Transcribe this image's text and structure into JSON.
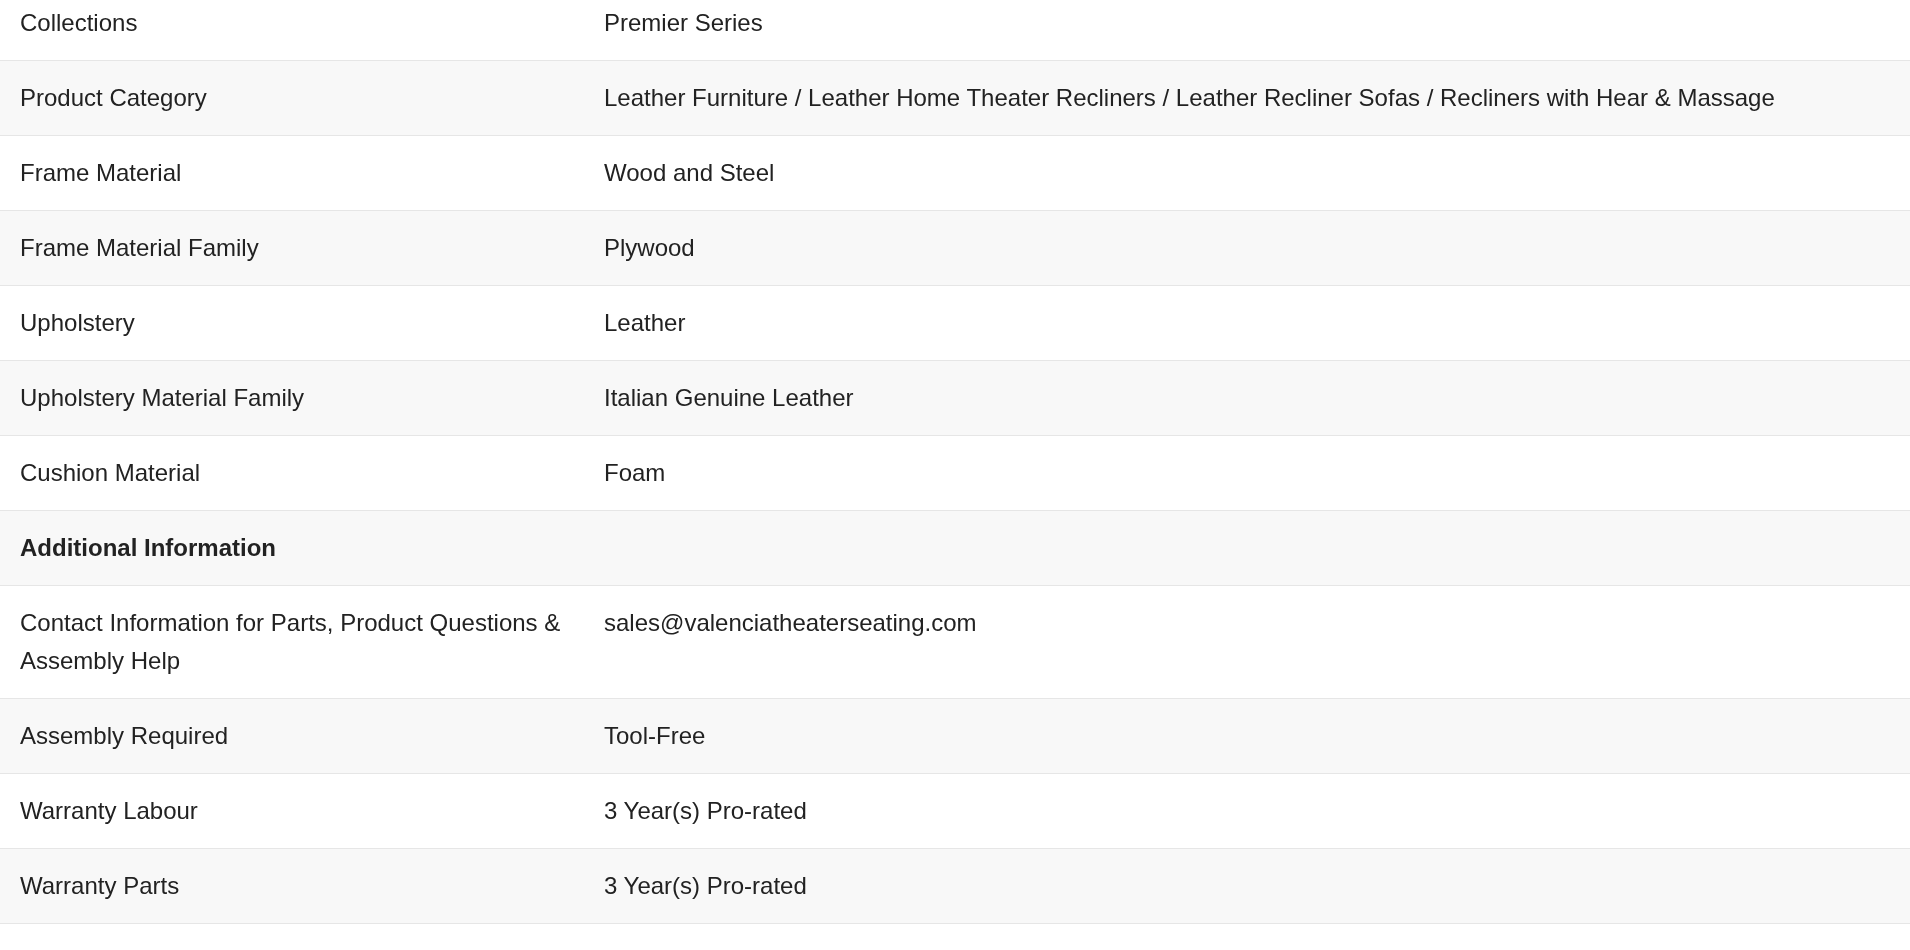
{
  "rows": [
    {
      "kind": "pair",
      "label": "Collections",
      "value": "Premier Series"
    },
    {
      "kind": "pair",
      "label": "Product Category",
      "value": "Leather Furniture / Leather Home Theater Recliners / Leather Recliner Sofas / Recliners with Hear & Massage"
    },
    {
      "kind": "pair",
      "label": "Frame Material",
      "value": "Wood and Steel"
    },
    {
      "kind": "pair",
      "label": "Frame Material Family",
      "value": "Plywood"
    },
    {
      "kind": "pair",
      "label": "Upholstery",
      "value": "Leather"
    },
    {
      "kind": "pair",
      "label": "Upholstery Material Family",
      "value": "Italian Genuine Leather"
    },
    {
      "kind": "pair",
      "label": "Cushion Material",
      "value": "Foam"
    },
    {
      "kind": "section",
      "label": "Additional Information"
    },
    {
      "kind": "pair",
      "label": "Contact Information for Parts, Product Questions & Assembly Help",
      "value": "sales@valenciatheaterseating.com"
    },
    {
      "kind": "pair",
      "label": "Assembly Required",
      "value": "Tool-Free"
    },
    {
      "kind": "pair",
      "label": "Warranty Labour",
      "value": "3 Year(s) Pro-rated"
    },
    {
      "kind": "pair",
      "label": "Warranty Parts",
      "value": "3 Year(s) Pro-rated"
    }
  ]
}
